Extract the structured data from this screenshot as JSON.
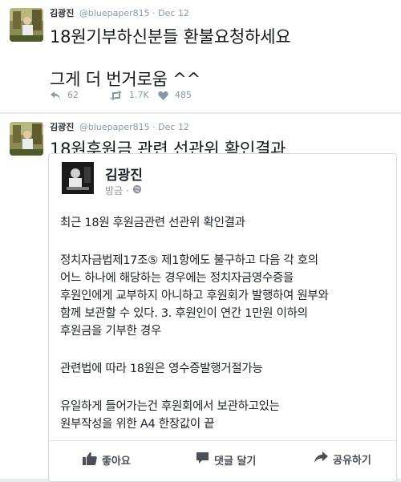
{
  "tweets": [
    {
      "author": "김광진",
      "handle": "@bluepaper815",
      "date": "Dec 12",
      "text_lines": [
        "18원기부하신분들 환불요청하세요",
        "그게 더 번거로움 ^^"
      ],
      "actions": {
        "reply": "62",
        "retweet": "1.7K",
        "like": "485"
      }
    },
    {
      "author": "김광진",
      "handle": "@bluepaper815",
      "date": "Dec 12",
      "text_lines": [
        "18원후원금 관련 선관위 확인결과"
      ],
      "embed": {
        "name": "김광진",
        "meta": "방금",
        "lines": [
          "최근 18원 후원금관련 선관위 확인결과",
          "정치자금법제17조⑤ 제1항에도 불구하고 다음 각 호의",
          "어느 하나에 해당하는 경우에는 정치자금영수증을",
          "후원인에게 교부하지 아니하고 후원회가 발행하여 원부와",
          "함께 보관할 수 있다. 3. 후원인이 연간 1만원 이하의",
          "후원금을 기부한 경우",
          "관련법에 따라 18원은 영수증발행거절가능",
          "유일하게 들어가는건 후원회에서 보관하고있는",
          "원부작성을 위한 A4 한장값이 끝"
        ],
        "actions": {
          "like": "좋아요",
          "comment": "댓글 달기",
          "share": "공유하기"
        }
      }
    }
  ],
  "colors": {
    "background": "#e6ecf0",
    "muted": "#8899a6",
    "text": "#14171a"
  },
  "icons": [
    "reply-icon",
    "retweet-icon",
    "heart-icon",
    "globe-icon",
    "thumbs-up-icon",
    "comment-icon",
    "share-icon"
  ]
}
